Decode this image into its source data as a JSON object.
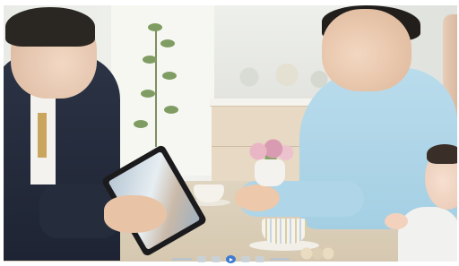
{
  "player": {
    "video_description_icon": "video-frame",
    "controls": [
      {
        "name": "volume-icon"
      },
      {
        "name": "rewind-icon"
      },
      {
        "name": "previous-icon"
      },
      {
        "name": "play-icon"
      },
      {
        "name": "next-icon"
      },
      {
        "name": "fast-forward-icon"
      },
      {
        "name": "fullscreen-icon"
      }
    ],
    "accent_color": "#3e7bd0"
  }
}
